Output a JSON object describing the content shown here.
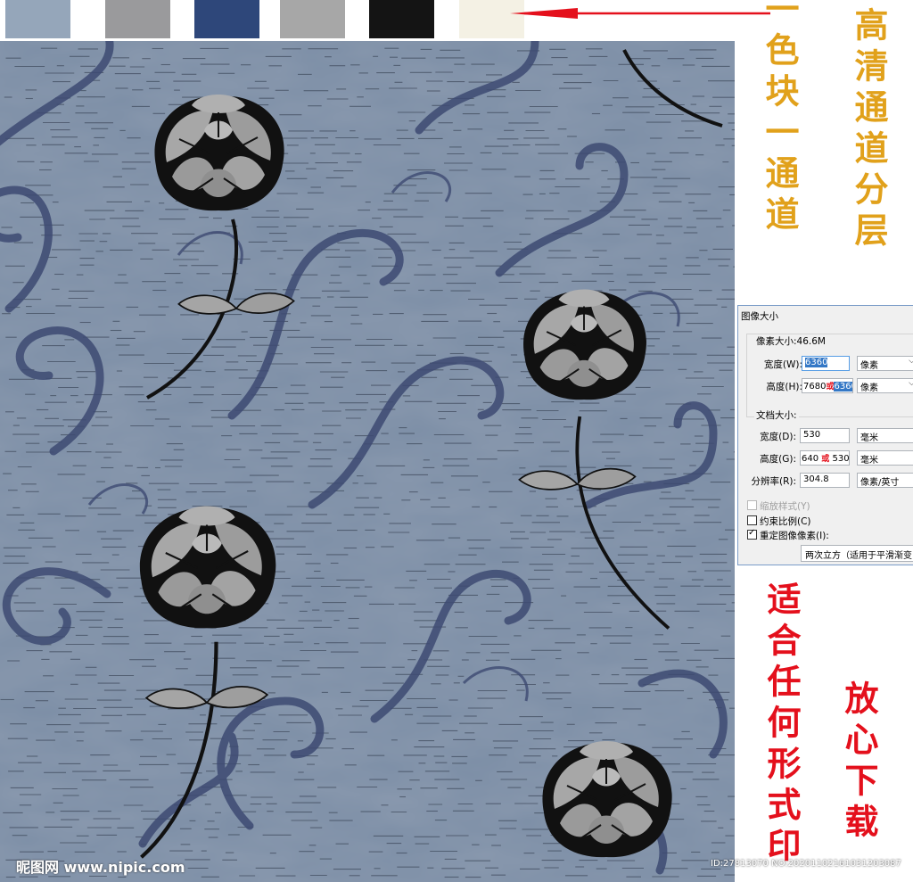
{
  "swatches": {
    "colors": [
      "#95a6ba",
      "#9a9a9c",
      "#2e477a",
      "#a7a7a7",
      "#141414",
      "#f4f1e4"
    ]
  },
  "annotations": {
    "top_right_gold": "高清通道分层",
    "top_left_gold": "一色块一通道",
    "mid_red": "适合任何形式印",
    "bottom_red": "放心下载",
    "arrow_color": "#e4101c"
  },
  "dialog": {
    "title": "图像大小",
    "pixel_size": "像素大小:46.6M",
    "width_label": "宽度(W):",
    "width_value": "6360",
    "width_unit": "像素",
    "height_label": "高度(H):",
    "height_value_a": "7680",
    "height_value_b": "6360",
    "height_unit": "像素",
    "doc_size": "文档大小:",
    "doc_width_label": "宽度(D):",
    "doc_width_value": "530",
    "doc_width_unit": "毫米",
    "doc_height_label": "高度(G):",
    "doc_height_value_a": "640",
    "doc_height_value_b": "530",
    "doc_height_unit": "毫米",
    "resolution_label": "分辨率(R):",
    "resolution_value": "304.8",
    "resolution_unit": "像素/英寸",
    "scale_styles": "缩放样式(Y)",
    "constrain": "约束比例(C)",
    "resample": "重定图像像素(I):",
    "resample_method": "两次立方（适用于平滑渐变",
    "or_mark": "或"
  },
  "watermark": {
    "site": "昵图网 www.nipic.com",
    "id_line": "ID:27813070 NO:20201102161031203087"
  },
  "pattern": {
    "background": "#7c8ea6",
    "vine_color": "#3d4a72",
    "flower_fill": "#a2a2a2",
    "flower_ink": "#111111"
  }
}
